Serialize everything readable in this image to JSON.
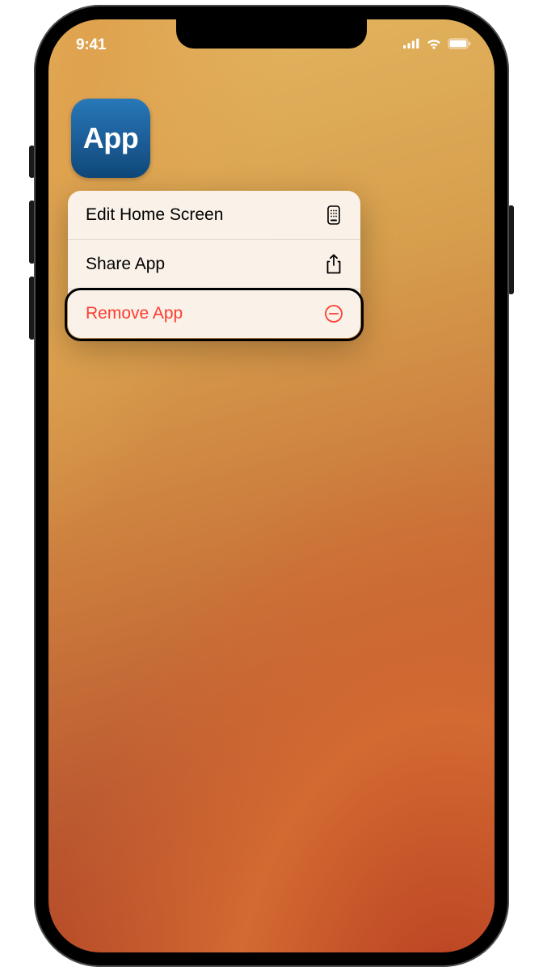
{
  "status_bar": {
    "time": "9:41"
  },
  "app": {
    "label": "App"
  },
  "context_menu": {
    "items": [
      {
        "label": "Edit Home Screen",
        "icon": "phone-grid-icon",
        "destructive": false
      },
      {
        "label": "Share App",
        "icon": "share-icon",
        "destructive": false
      },
      {
        "label": "Remove App",
        "icon": "remove-circle-icon",
        "destructive": true
      }
    ]
  },
  "colors": {
    "destructive": "#ff3b30",
    "app_icon_bg_top": "#2878b8",
    "app_icon_bg_bottom": "#0f4878"
  }
}
